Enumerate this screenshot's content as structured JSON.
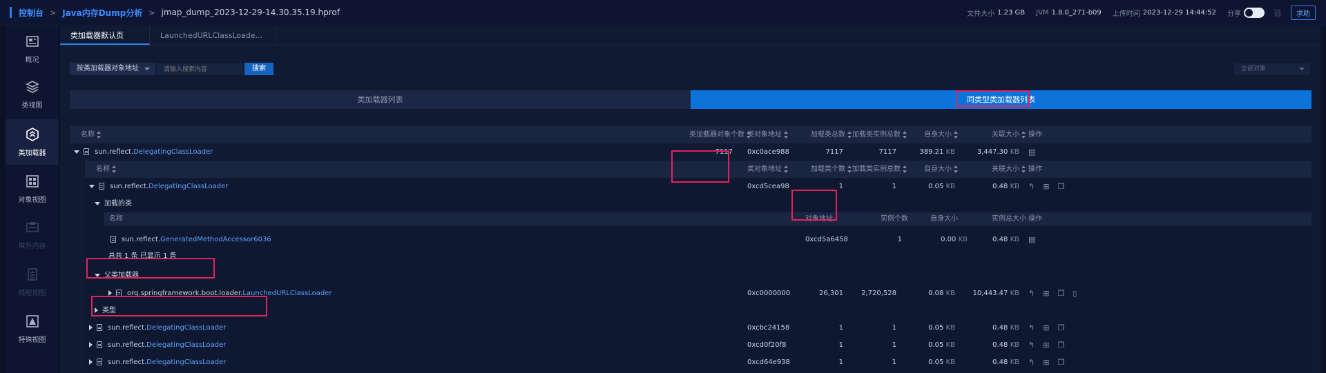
{
  "topbar": {
    "crumbs": [
      "控制台",
      "Java内存Dump分析",
      "jmap_dump_2023-12-29-14.30.35.19.hprof"
    ],
    "separator": ">",
    "file_size_label": "文件大小",
    "file_size": "1.23 GB",
    "jvm_label": "JVM",
    "jvm": "1.8.0_271-b09",
    "upload_label": "上传时间",
    "upload_time": "2023-12-29 14:44:52",
    "share_label": "分享",
    "help": "求助"
  },
  "sidebar": {
    "items": [
      {
        "label": "概况",
        "icon": "overview-icon"
      },
      {
        "label": "类视图",
        "icon": "layers-icon"
      },
      {
        "label": "类加载器",
        "icon": "classloader-icon"
      },
      {
        "label": "对象视图",
        "icon": "grid-icon"
      },
      {
        "label": "堆外内存",
        "icon": "offheap-icon"
      },
      {
        "label": "线程视图",
        "icon": "thread-icon"
      },
      {
        "label": "特殊视图",
        "icon": "warning-icon"
      }
    ]
  },
  "tabs": [
    "类加载器默认页",
    "LaunchedURLClassLoade..."
  ],
  "filter": {
    "select": "按类加载器对象地址",
    "placeholder": "请输入搜索内容",
    "search": "搜索",
    "all_objects": "全部对象"
  },
  "segments": {
    "left": "类加载器列表",
    "right": "同类型类加载器列表"
  },
  "table": {
    "headers": {
      "name": "名称",
      "loader_count": "类加载器对象个数",
      "address": "类对象地址",
      "class_total": "加载类总数",
      "instance_total": "加载类实例总数",
      "self_size": "自身大小",
      "retained": "关联大小",
      "ops": "操作"
    },
    "top_row": {
      "pkg": "sun.reflect.",
      "cls": "DelegatingClassLoader",
      "loader_count": "7117",
      "address": "0xc0ace988",
      "class_total": "7117",
      "instance_total": "7117",
      "self_size": "389.21",
      "self_unit": "KB",
      "retained": "3,447.30",
      "retained_unit": "KB"
    },
    "sub_headers": {
      "name": "名称",
      "address": "类对象地址",
      "class_count": "加载类个数",
      "instance_total": "加载类实例总数",
      "self_size": "自身大小",
      "retained": "关联大小",
      "ops": "操作"
    },
    "expanded": {
      "pkg": "sun.reflect.",
      "cls": "DelegatingClassLoader",
      "address": "0xcd5cea98",
      "class_count": "1",
      "instance_total": "1",
      "self_size": "0.05",
      "self_unit": "KB",
      "retained": "0.48",
      "retained_unit": "KB"
    },
    "loaded_section": "加载的类",
    "loaded_headers": {
      "name": "名称",
      "address": "对象地址",
      "instances": "实例个数",
      "self_size": "自身大小",
      "instance_size": "实例总大小",
      "ops": "操作"
    },
    "loaded_row": {
      "pkg": "sun.reflect.",
      "cls": "GeneratedMethodAccessor6036",
      "address": "0xcd5a6458",
      "instances": "1",
      "self_size": "0.00",
      "self_unit": "KB",
      "instance_size": "0.48",
      "instance_unit": "KB"
    },
    "loaded_total": "总共 1 条  已显示 1 条",
    "parent_section": "父类加载器",
    "parent_row": {
      "pkg": "org.springframework.boot.loader.",
      "cls": "LaunchedURLClassLoader",
      "address": "0xc0000000",
      "class_count": "26,301",
      "instance_total": "2,720,528",
      "self_size": "0.08",
      "self_unit": "KB",
      "retained": "10,443.47",
      "retained_unit": "KB"
    },
    "type_section": "类型",
    "rows": [
      {
        "pkg": "sun.reflect.",
        "cls": "DelegatingClassLoader",
        "address": "0xcbc24158",
        "class_count": "1",
        "instance_total": "1",
        "self_size": "0.05",
        "unit": "KB",
        "retained": "0.48"
      },
      {
        "pkg": "sun.reflect.",
        "cls": "DelegatingClassLoader",
        "address": "0xcd0f20f8",
        "class_count": "1",
        "instance_total": "1",
        "self_size": "0.05",
        "unit": "KB",
        "retained": "0.48"
      },
      {
        "pkg": "sun.reflect.",
        "cls": "DelegatingClassLoader",
        "address": "0xcd64e938",
        "class_count": "1",
        "instance_total": "1",
        "self_size": "0.05",
        "unit": "KB",
        "retained": "0.48"
      }
    ]
  },
  "colors": {
    "accent": "#2f80ed",
    "highlight": "#e0245e",
    "segment_active": "#0b73d9"
  }
}
